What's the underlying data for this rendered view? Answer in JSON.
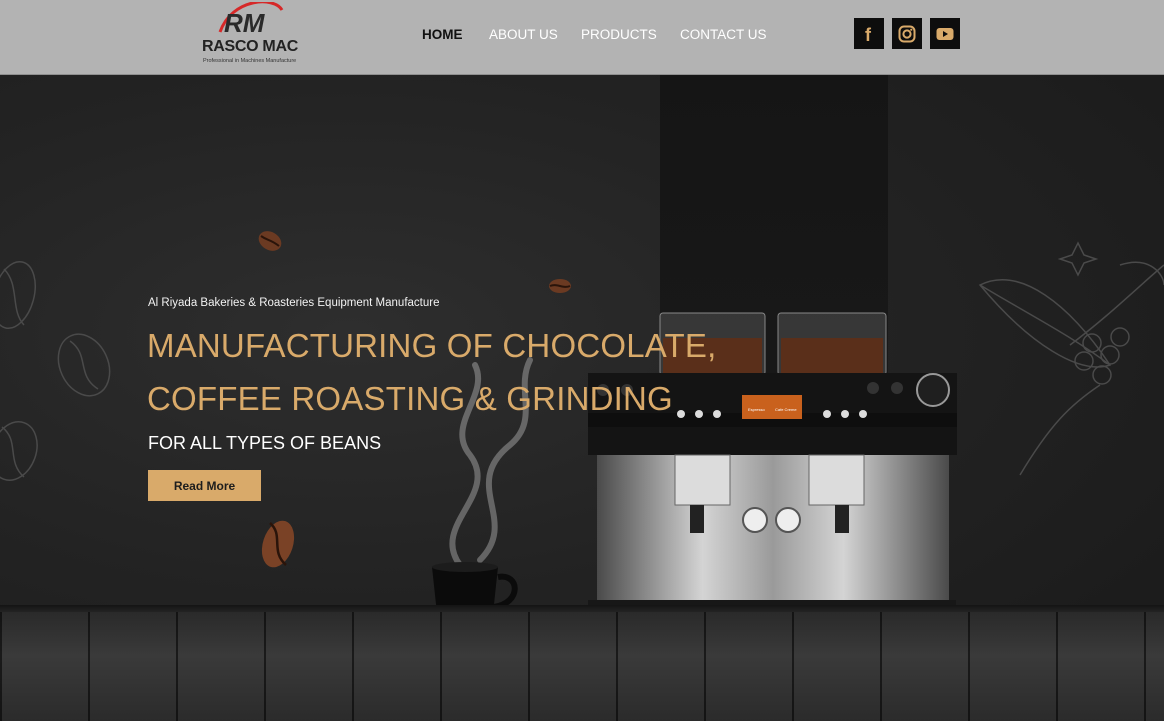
{
  "header": {
    "logo": {
      "monogram": "RM",
      "name": "RASCO MAC",
      "tagline": "Professional in Machines Manufacture"
    },
    "nav": [
      {
        "label": "HOME",
        "active": true
      },
      {
        "label": "ABOUT US",
        "active": false
      },
      {
        "label": "PRODUCTS",
        "active": false
      },
      {
        "label": "CONTACT US",
        "active": false
      }
    ],
    "social": [
      {
        "icon": "facebook-icon"
      },
      {
        "icon": "instagram-icon"
      },
      {
        "icon": "youtube-icon"
      }
    ]
  },
  "hero": {
    "subtitle": "Al Riyada Bakeries & Roasteries Equipment Manufacture",
    "headline_line1": "MANUFACTURING OF CHOCOLATE,",
    "headline_line2": "COFFEE ROASTING & GRINDING",
    "tagline": "FOR ALL TYPES OF BEANS",
    "cta_label": "Read More",
    "machine_display": {
      "left": "Espresso",
      "right": "Cafe Creme"
    }
  },
  "colors": {
    "header_bg": "#b3b3b3",
    "accent_gold": "#d9aa6a",
    "hero_bg": "#232323",
    "logo_red": "#d62828"
  }
}
